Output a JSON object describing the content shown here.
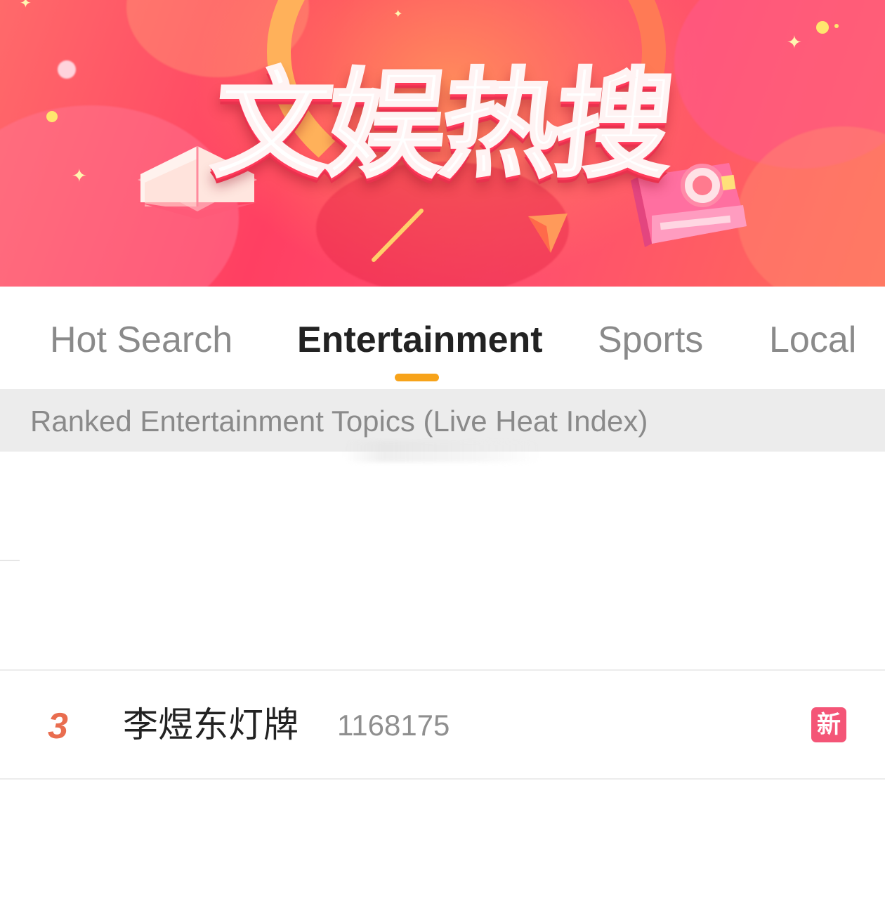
{
  "banner": {
    "title": "文娱热搜"
  },
  "tabs": [
    {
      "label": "Hot Search",
      "active": false
    },
    {
      "label": "Entertainment",
      "active": true
    },
    {
      "label": "Sports",
      "active": false
    },
    {
      "label": "Local",
      "active": false
    }
  ],
  "subheader": {
    "text": "Ranked Entertainment Topics (Live Heat Index)"
  },
  "list": [
    {
      "rank": "3",
      "topic": "李煜东灯牌",
      "heat": "1168175",
      "badge": "新"
    }
  ],
  "colors": {
    "banner_primary": "#ff3f62",
    "tab_active_underline": "#f7a31a",
    "rank_color": "#e96d4f",
    "badge_new": "#f45577"
  },
  "icons": [
    "book-illustration",
    "camera-illustration",
    "sparkle-icon"
  ]
}
